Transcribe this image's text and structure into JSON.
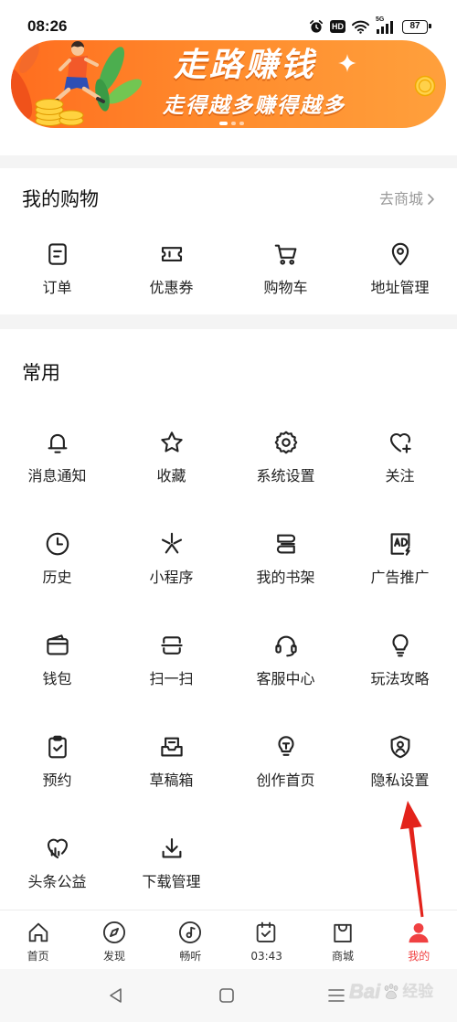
{
  "status_bar": {
    "time": "08:26",
    "hd_label": "HD",
    "network_label": "5G",
    "battery_level": "87",
    "icons": [
      "alarm-icon",
      "wifi-icon",
      "signal-icon",
      "battery-icon"
    ]
  },
  "banner": {
    "title": "走路赚钱",
    "subtitle": "走得越多赚得越多",
    "gradient": [
      "#ff6d1f",
      "#ffa03c"
    ]
  },
  "shopping": {
    "title": "我的购物",
    "link_label": "去商城",
    "items": [
      {
        "label": "订单",
        "icon": "order-icon"
      },
      {
        "label": "优惠券",
        "icon": "coupon-icon"
      },
      {
        "label": "购物车",
        "icon": "cart-icon"
      },
      {
        "label": "地址管理",
        "icon": "location-icon"
      }
    ]
  },
  "common": {
    "title": "常用",
    "items": [
      {
        "label": "消息通知",
        "icon": "bell-icon"
      },
      {
        "label": "收藏",
        "icon": "star-icon"
      },
      {
        "label": "系统设置",
        "icon": "gear-icon"
      },
      {
        "label": "关注",
        "icon": "heart-plus-icon"
      },
      {
        "label": "历史",
        "icon": "clock-icon"
      },
      {
        "label": "小程序",
        "icon": "mini-program-icon"
      },
      {
        "label": "我的书架",
        "icon": "bookshelf-icon"
      },
      {
        "label": "广告推广",
        "icon": "ad-icon"
      },
      {
        "label": "钱包",
        "icon": "wallet-icon"
      },
      {
        "label": "扫一扫",
        "icon": "scan-icon"
      },
      {
        "label": "客服中心",
        "icon": "headset-icon"
      },
      {
        "label": "玩法攻略",
        "icon": "lightbulb-icon"
      },
      {
        "label": "预约",
        "icon": "clipboard-check-icon"
      },
      {
        "label": "草稿箱",
        "icon": "draft-box-icon"
      },
      {
        "label": "创作首页",
        "icon": "creator-bulb-icon"
      },
      {
        "label": "隐私设置",
        "icon": "shield-user-icon"
      },
      {
        "label": "头条公益",
        "icon": "charity-heart-icon"
      },
      {
        "label": "下载管理",
        "icon": "download-icon"
      }
    ]
  },
  "bottom_nav": {
    "active_index": 5,
    "items": [
      {
        "label": "首页",
        "icon": "home-icon"
      },
      {
        "label": "发现",
        "icon": "compass-icon"
      },
      {
        "label": "畅听",
        "icon": "music-disc-icon"
      },
      {
        "label": "03:43",
        "icon": "calendar-check-icon"
      },
      {
        "label": "商城",
        "icon": "shopping-bag-icon"
      },
      {
        "label": "我的",
        "icon": "person-icon"
      }
    ]
  },
  "system_nav": {
    "buttons": [
      "back-icon",
      "home-square-icon",
      "recents-menu-icon"
    ]
  },
  "watermark": {
    "brand": "Bai",
    "text": "经验"
  },
  "colors": {
    "accent_red": "#f04142",
    "link_gray": "#999999",
    "annotation_arrow": "#e3231b",
    "divider": "#f4f4f4"
  }
}
